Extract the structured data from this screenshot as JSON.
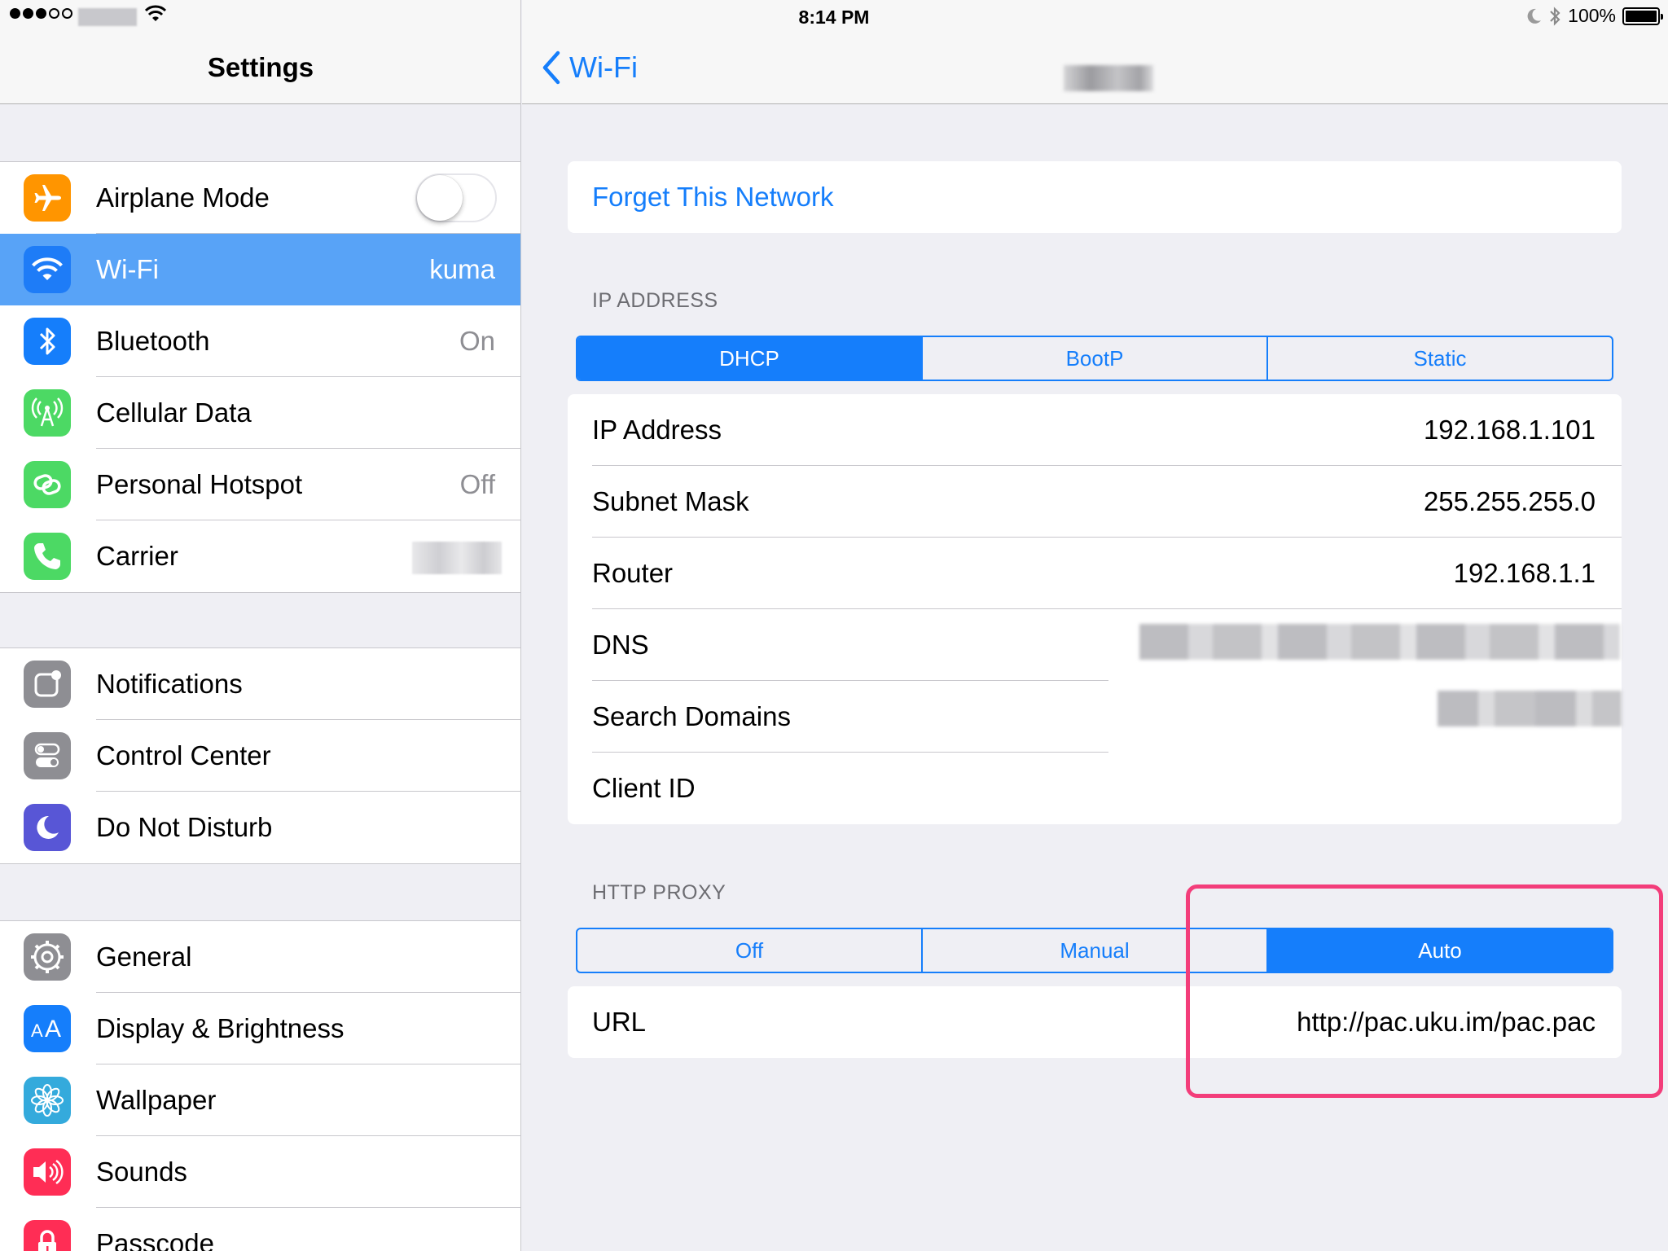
{
  "status_bar": {
    "time": "8:14 PM",
    "battery": "100%",
    "signal_bars_filled": 3,
    "signal_bars_total": 5
  },
  "master": {
    "title": "Settings",
    "groups": [
      [
        {
          "label": "Airplane Mode",
          "icon": "airplane-icon",
          "color": "#ff9500",
          "toggle": false
        },
        {
          "label": "Wi-Fi",
          "value": "kuma",
          "icon": "wifi-icon",
          "color": "#157efb",
          "selected": true
        },
        {
          "label": "Bluetooth",
          "value": "On",
          "icon": "bluetooth-icon",
          "color": "#157efb"
        },
        {
          "label": "Cellular Data",
          "icon": "cellular-icon",
          "color": "#4cd964"
        },
        {
          "label": "Personal Hotspot",
          "value": "Off",
          "icon": "hotspot-icon",
          "color": "#4cd964"
        },
        {
          "label": "Carrier",
          "icon": "phone-icon",
          "color": "#4cd964"
        }
      ],
      [
        {
          "label": "Notifications",
          "icon": "notifications-icon",
          "color": "#8e8e93"
        },
        {
          "label": "Control Center",
          "icon": "control-center-icon",
          "color": "#8e8e93"
        },
        {
          "label": "Do Not Disturb",
          "icon": "moon-icon",
          "color": "#5856d6"
        }
      ],
      [
        {
          "label": "General",
          "icon": "gear-icon",
          "color": "#8e8e93"
        },
        {
          "label": "Display & Brightness",
          "icon": "text-size-icon",
          "color": "#157efb"
        },
        {
          "label": "Wallpaper",
          "icon": "flower-icon",
          "color": "#34aadc"
        },
        {
          "label": "Sounds",
          "icon": "speaker-icon",
          "color": "#ff2d55"
        },
        {
          "label": "Passcode",
          "icon": "lock-icon",
          "color": "#ff2d55"
        }
      ]
    ]
  },
  "detail": {
    "back_label": "Wi-Fi",
    "forget_label": "Forget This Network",
    "ip_section": "IP ADDRESS",
    "ip_modes": [
      "DHCP",
      "BootP",
      "Static"
    ],
    "ip_mode_selected": 0,
    "ip_rows": [
      {
        "key": "IP Address",
        "value": "192.168.1.101"
      },
      {
        "key": "Subnet Mask",
        "value": "255.255.255.0"
      },
      {
        "key": "Router",
        "value": "192.168.1.1"
      },
      {
        "key": "DNS",
        "value": ""
      },
      {
        "key": "Search Domains",
        "value": ""
      },
      {
        "key": "Client ID",
        "value": ""
      }
    ],
    "proxy_section": "HTTP PROXY",
    "proxy_modes": [
      "Off",
      "Manual",
      "Auto"
    ],
    "proxy_mode_selected": 2,
    "url_label": "URL",
    "url_value": "http://pac.uku.im/pac.pac"
  },
  "colors": {
    "accent": "#157efb",
    "selected_row": "#58a3f7",
    "highlight": "#f33d7a",
    "background": "#efeff4"
  }
}
